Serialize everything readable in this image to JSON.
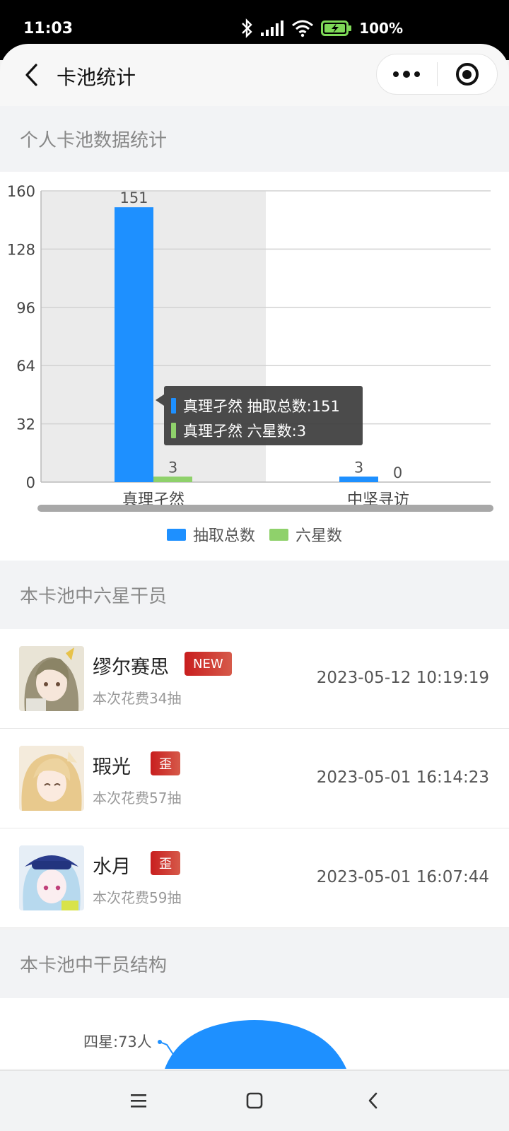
{
  "status_bar": {
    "time": "11:03",
    "battery": "100%"
  },
  "nav": {
    "title": "卡池统计"
  },
  "sections": {
    "personal_stats": "个人卡池数据统计",
    "six_star": "本卡池中六星干员",
    "structure": "本卡池中干员结构"
  },
  "chart_data": {
    "type": "bar",
    "categories": [
      "真理孑然",
      "中坚寻访"
    ],
    "series": [
      {
        "name": "抽取总数",
        "values": [
          151,
          3
        ],
        "color": "#1e90ff"
      },
      {
        "name": "六星数",
        "values": [
          3,
          0
        ],
        "color": "#8fd16b"
      }
    ],
    "ylim": [
      0,
      160
    ],
    "yticks": [
      0,
      32,
      64,
      96,
      128,
      160
    ],
    "grid": true,
    "legend": "bottom",
    "highlighted_category": "真理孑然"
  },
  "tooltip": {
    "line1": "真理孑然 抽取总数:151",
    "line2": "真理孑然 六星数:3"
  },
  "legend": {
    "total_label": "抽取总数",
    "six_label": "六星数"
  },
  "operators": [
    {
      "name": "缪尔赛思",
      "badge": "NEW",
      "cost": "本次花费34抽",
      "time": "2023-05-12 10:19:19"
    },
    {
      "name": "瑕光",
      "badge": "歪",
      "cost": "本次花费57抽",
      "time": "2023-05-01 16:14:23"
    },
    {
      "name": "水月",
      "badge": "歪",
      "cost": "本次花费59抽",
      "time": "2023-05-01 16:07:44"
    }
  ],
  "pie": {
    "label_four_star": "四星:73人"
  }
}
